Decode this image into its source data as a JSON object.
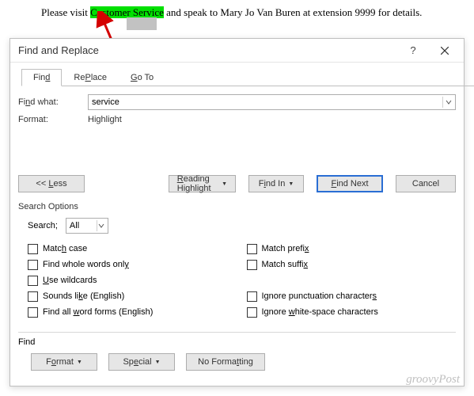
{
  "document": {
    "before_highlight": "Please visit ",
    "highlighted": "Customer Service",
    "after_highlight": " and speak to Mary Jo Van Buren at extension 9999 for details."
  },
  "dialog": {
    "title": "Find and Replace",
    "help_label": "?",
    "tabs": {
      "find": "Find",
      "find_key": "d",
      "replace": "Replace",
      "replace_key": "P",
      "goto": "Go To",
      "goto_key": "G"
    },
    "find_what_label": "Find what:",
    "find_what_value": "service",
    "format_label": "Format:",
    "format_value": "Highlight",
    "buttons": {
      "less": "<< Less",
      "reading_highlight": "Reading Highlight",
      "find_in": "Find In",
      "find_next": "Find Next",
      "cancel": "Cancel"
    },
    "search_options_legend": "Search Options",
    "search_label": "Search;",
    "search_value": "All",
    "checkboxes_left": {
      "match_case": "Match case",
      "whole_words": "Find whole words only",
      "use_wildcards": "Use wildcards",
      "sounds_like": "Sounds like (English)",
      "word_forms": "Find all word forms (English)"
    },
    "checkboxes_right": {
      "match_prefix": "Match prefix",
      "match_suffix": "Match suffix",
      "ignore_punct": "Ignore punctuation characters",
      "ignore_ws": "Ignore white-space characters"
    },
    "find_section": "Find",
    "bottom": {
      "format": "Format",
      "special": "Special",
      "no_formatting": "No Formatting"
    }
  },
  "watermark": "groovyPost"
}
